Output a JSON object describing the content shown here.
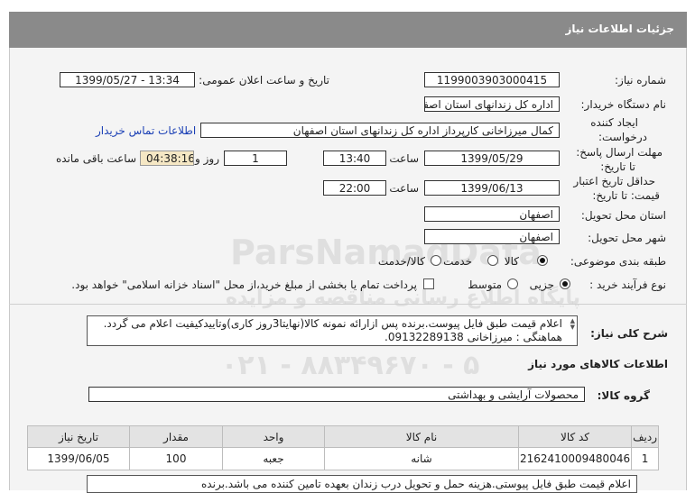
{
  "header": {
    "title": "جزئیات اطلاعات نیاز"
  },
  "form": {
    "need_number_label": "شماره نیاز:",
    "need_number": "1199003903000415",
    "announce_label": "تاریخ و ساعت اعلان عمومی:",
    "announce_value": "1399/05/27 - 13:34",
    "buyer_label": "نام دستگاه خریدار:",
    "buyer": "اداره کل زندانهای استان اصفهان",
    "creator_label_1": "ایجاد کننده",
    "creator_label_2": "درخواست:",
    "creator": "کمال میرزاخانی کارپرداز اداره کل زندانهای استان اصفهان",
    "contact_link": "اطلاعات تماس خریدار",
    "deadline_label_1": "مهلت ارسال پاسخ:",
    "deadline_label_2": "تا تاریخ:",
    "deadline_date": "1399/05/29",
    "time_label": "ساعت",
    "deadline_time": "13:40",
    "days_value": "1",
    "days_label": "روز و",
    "remaining_time": "04:38:16",
    "remaining_label": "ساعت باقی مانده",
    "validity_label_1": "حداقل تاریخ اعتبار",
    "validity_label_2": "قیمت: تا تاریخ:",
    "validity_date": "1399/06/13",
    "validity_time": "22:00",
    "province_label": "استان محل تحویل:",
    "province": "اصفهان",
    "city_label": "شهر محل تحویل:",
    "city": "اصفهان",
    "category_label": "طبقه بندی موضوعی:",
    "category_options": [
      "کالا",
      "خدمت",
      "کالا/خدمت"
    ],
    "category_selected": "کالا",
    "process_label": "نوع فرآیند خرید :",
    "process_options": [
      "جزیی",
      "متوسط"
    ],
    "process_selected": "جزیی",
    "payment_note": "پرداخت تمام یا بخشی از مبلغ خرید،از محل \"اسناد خزانه اسلامی\" خواهد بود."
  },
  "description": {
    "label": "شرح کلی نیاز:",
    "line1": "اعلام قیمت طبق فایل پیوست.برنده پس ازارائه نمونه کالا(نهایتا3روز کاری)وتاییدکیفیت اعلام می گردد.",
    "line2": "هماهنگی : میرزاخانی 09132289138."
  },
  "goods": {
    "section_title": "اطلاعات کالاهای مورد نیاز",
    "group_label": "گروه کالا:",
    "group_value": "محصولات آرایشی و بهداشتی",
    "columns": [
      "ردیف",
      "کد کالا",
      "نام کالا",
      "واحد",
      "مقدار",
      "تاریخ نیاز"
    ],
    "rows": [
      {
        "row": "1",
        "code": "2162410009480046",
        "name": "شانه",
        "unit": "جعبه",
        "qty": "100",
        "date": "1399/06/05"
      }
    ],
    "footnote": "اعلام قیمت طبق فایل پیوستی.هزینه حمل و تحویل درب زندان بعهده تامین کننده می باشد.برنده"
  },
  "watermark": {
    "line1": "ParsNamadData",
    "line2": "پایگاه اطلاع رسانی مناقصه و مزایده",
    "line3": "۰۲۱ - ۸۸۳۴۹۶۷۰ - ۵"
  }
}
